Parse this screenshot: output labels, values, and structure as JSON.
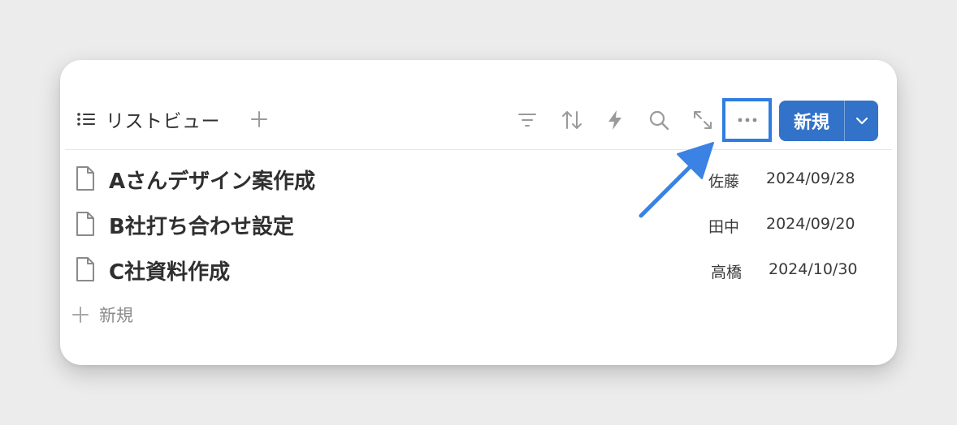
{
  "toolbar": {
    "view_label": "リストビュー",
    "new_button_label": "新規"
  },
  "icons": {
    "view": "list-icon",
    "add_view": "plus-icon",
    "filter": "filter-icon",
    "sort": "sort-icon",
    "automation": "lightning-icon",
    "search": "search-icon",
    "expand": "expand-icon",
    "more": "more-icon",
    "dropdown": "chevron-down-icon",
    "page": "page-icon"
  },
  "rows": [
    {
      "title": "Aさんデザイン案作成",
      "person": "佐藤",
      "date": "2024/09/28"
    },
    {
      "title": "B社打ち合わせ設定",
      "person": "田中",
      "date": "2024/09/20"
    },
    {
      "title": "C社資料作成",
      "person": "高橋",
      "date": "2024/10/30"
    }
  ],
  "add_row_label": "新規",
  "colors": {
    "accent": "#3272c8",
    "highlight": "#2f7de1",
    "arrow": "#3a82e4"
  }
}
